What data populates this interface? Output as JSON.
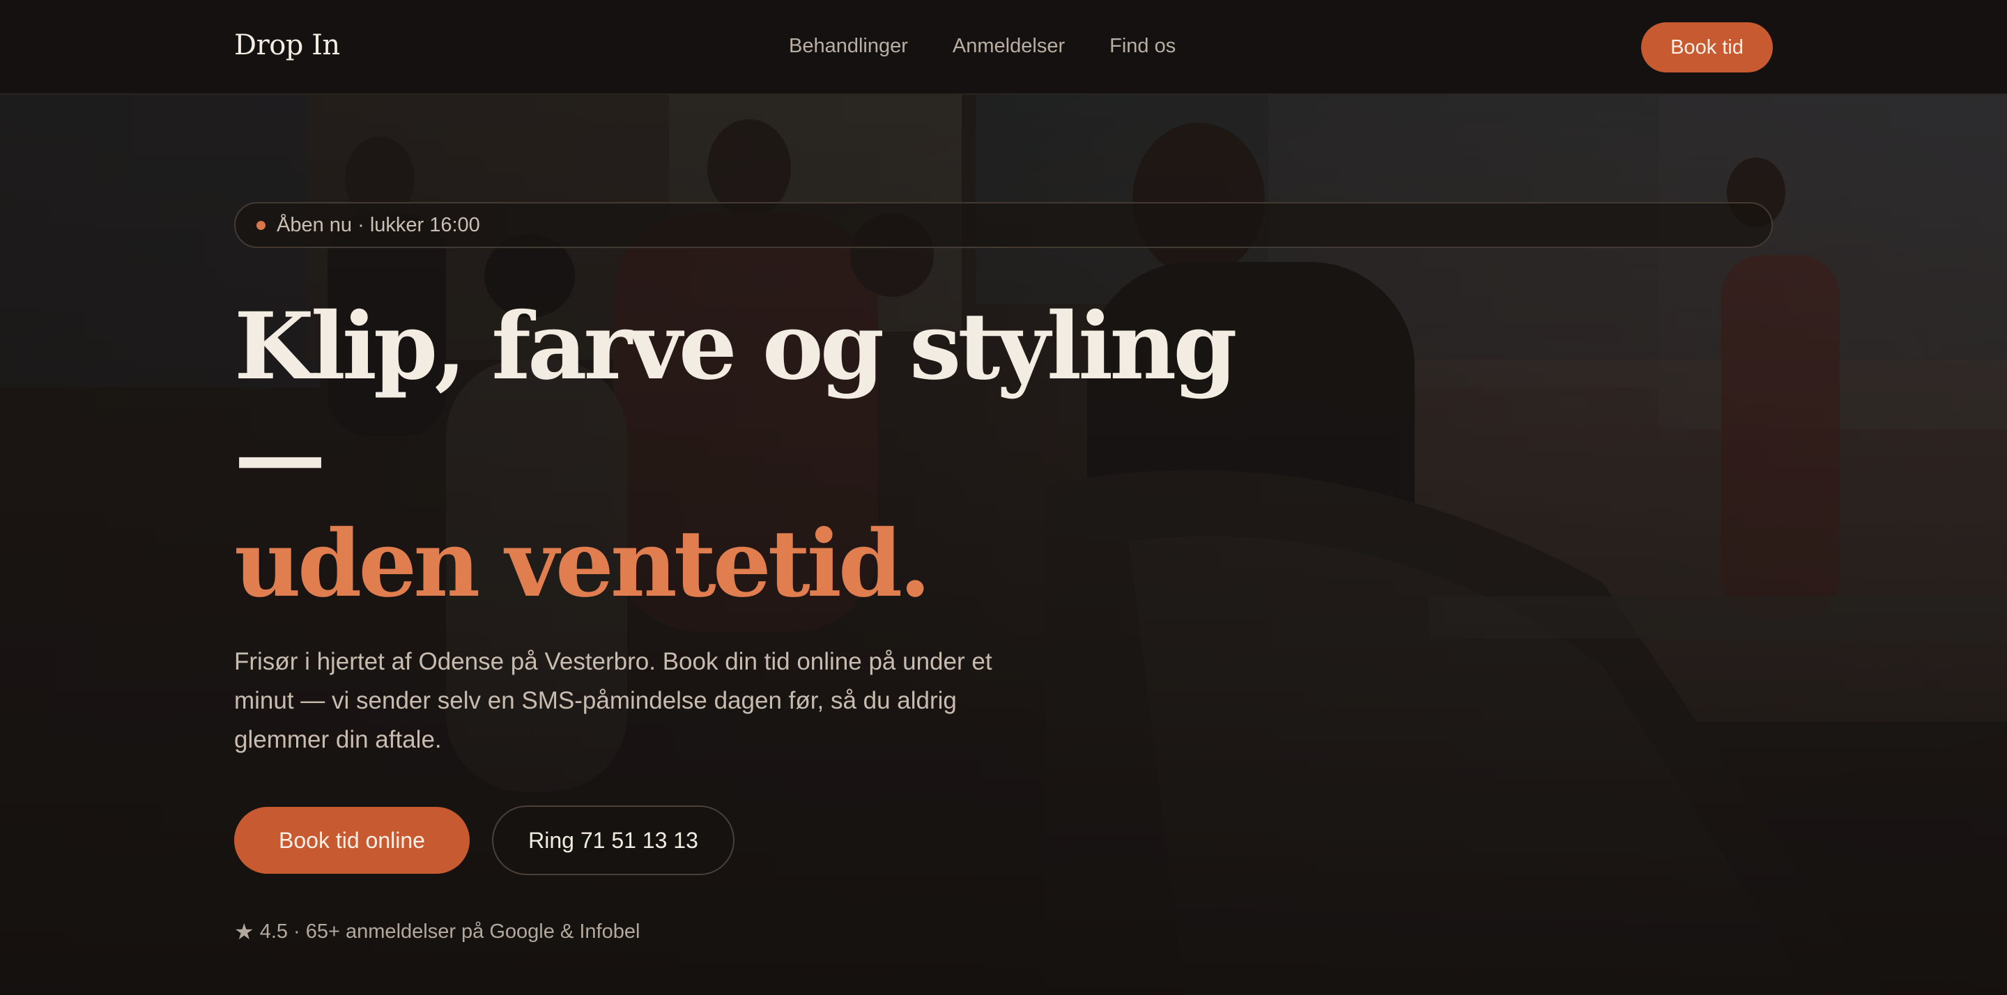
{
  "header": {
    "brand": "Drop In",
    "nav": [
      "Behandlinger",
      "Anmeldelser",
      "Find os"
    ],
    "book_label": "Book tid"
  },
  "hero": {
    "status": "Åben nu · lukker 16:00",
    "headline_line1": "Klip, farve og styling —",
    "headline_line2": "uden ventetid.",
    "lead": "Frisør i hjertet af Odense på Vesterbro. Book din tid online på under et minut — vi sender selv en SMS-påmindelse dagen før, så du aldrig glemmer din aftale.",
    "cta_primary": "Book tid online",
    "cta_secondary": "Ring 71 51 13 13",
    "rating_icon": "star-icon",
    "rating_text": "4.5 · 65+ anmeldelser på Google & Infobel"
  },
  "colors": {
    "accent": "#c75a31",
    "accent_text": "#e07e4f",
    "background": "#171310",
    "text_light": "#f3ece2"
  }
}
